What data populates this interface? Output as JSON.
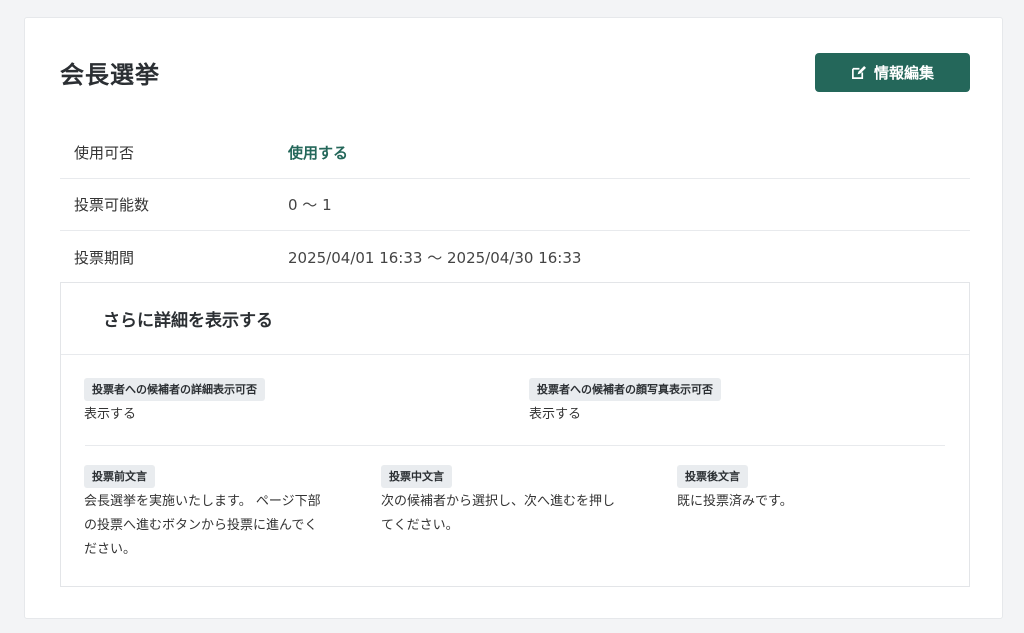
{
  "page": {
    "title": "会長選挙",
    "edit_button_label": "情報編集"
  },
  "info": {
    "rows": [
      {
        "label": "使用可否",
        "value": "使用する"
      },
      {
        "label": "投票可能数",
        "value": "0 〜 1"
      },
      {
        "label": "投票期間",
        "value": "2025/04/01 16:33 〜 2025/04/30 16:33"
      }
    ]
  },
  "details": {
    "toggle_label": "さらに詳細を表示する",
    "candidate_detail": {
      "label": "投票者への候補者の詳細表示可否",
      "value": "表示する"
    },
    "candidate_photo": {
      "label": "投票者への候補者の顔写真表示可否",
      "value": "表示する"
    },
    "pre_vote": {
      "label": "投票前文言",
      "lines": [
        "会長選挙を実施いたします。 ページ下部",
        "の投票へ進むボタンから投票に進んでく",
        "ださい。"
      ]
    },
    "mid_vote": {
      "label": "投票中文言",
      "lines": [
        "次の候補者から選択し、次へ進むを押し",
        "てください。"
      ]
    },
    "post_vote": {
      "label": "投票後文言",
      "lines": [
        "既に投票済みです。"
      ]
    }
  },
  "colors": {
    "accent": "#24675a",
    "badge_bg": "#e9ecef"
  },
  "icons": {
    "edit": "edit-icon"
  }
}
